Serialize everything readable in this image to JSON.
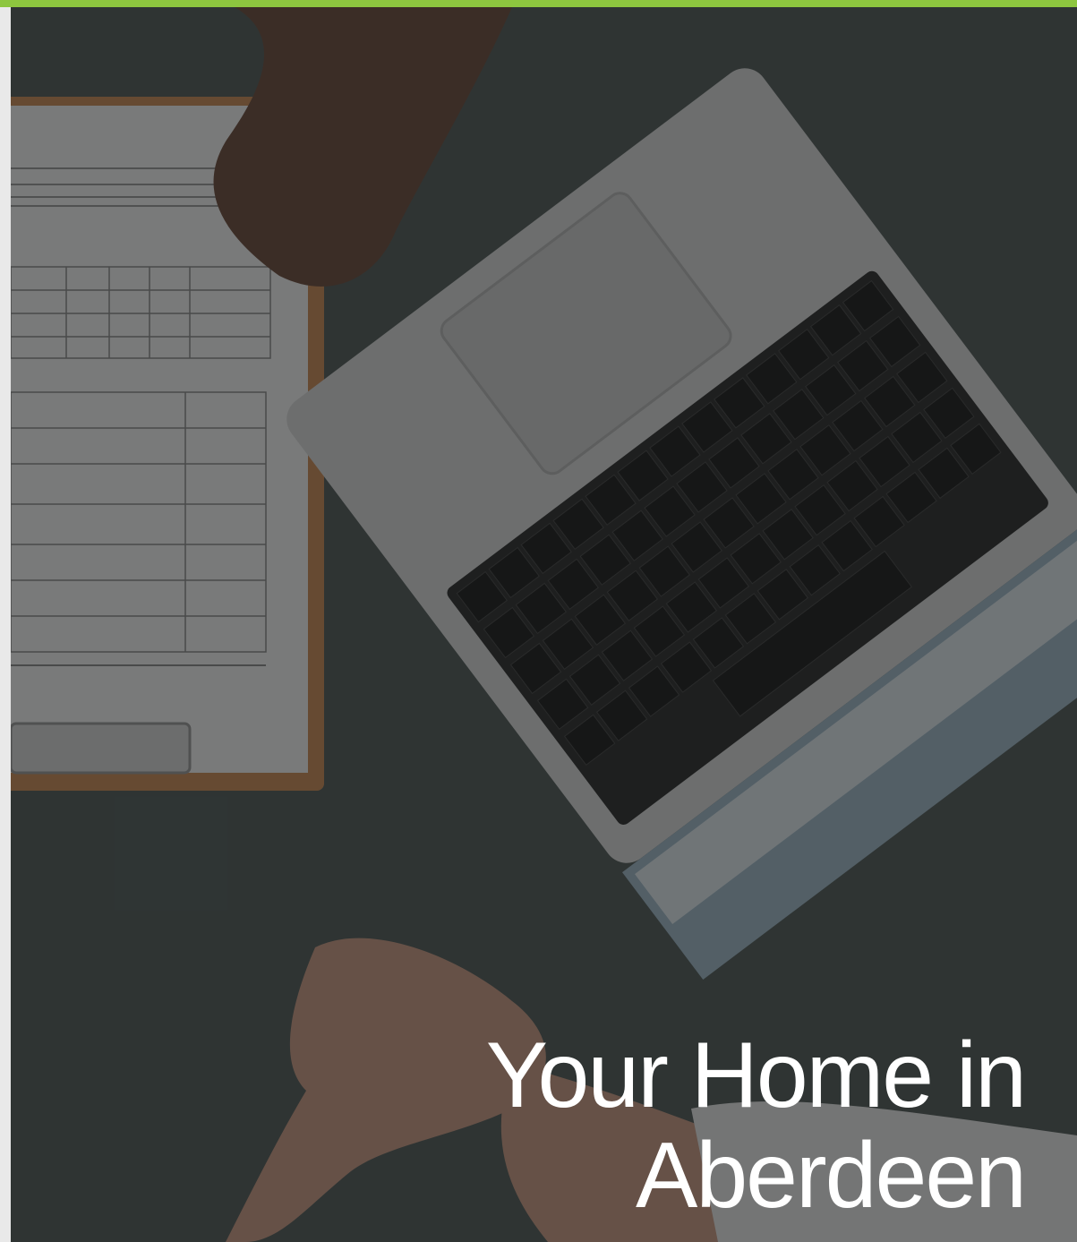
{
  "cover": {
    "title_line1": "Your Home in",
    "title_line2": "Aberdeen",
    "accent_color": "#8dc63f",
    "image_description_icon": "cover-photo"
  }
}
